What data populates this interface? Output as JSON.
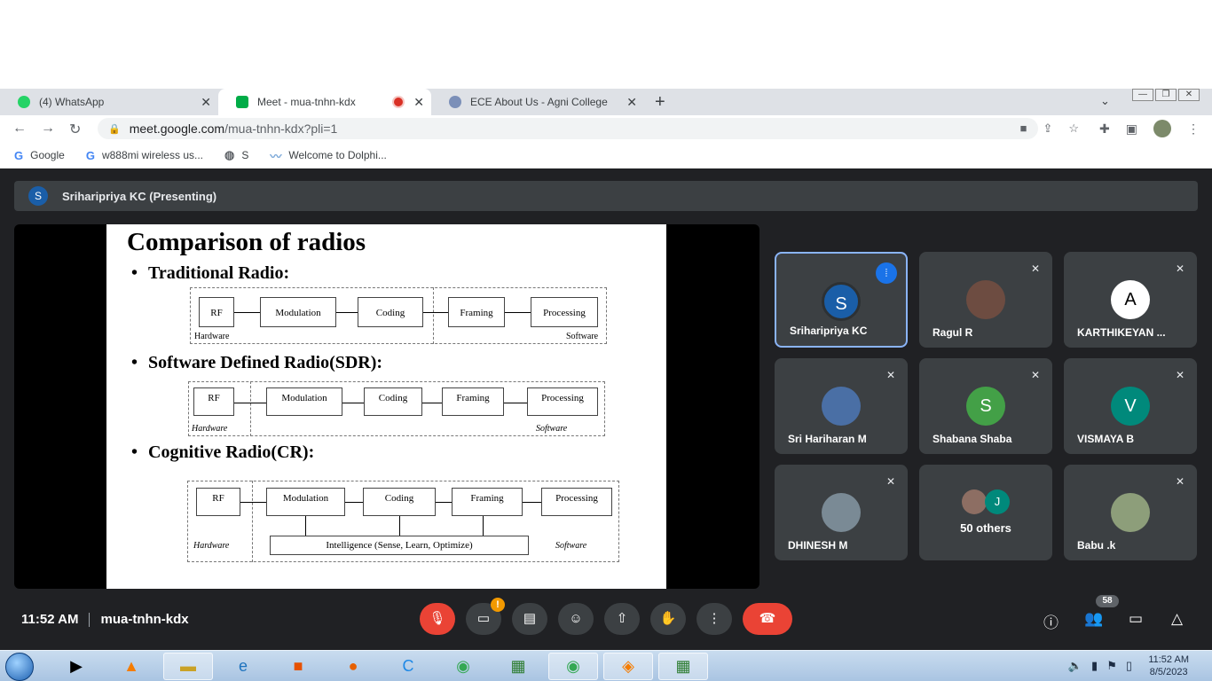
{
  "browser": {
    "tabs": [
      {
        "title": "(4) WhatsApp",
        "favicon_color": "#25d366"
      },
      {
        "title": "Meet - mua-tnhn-kdx",
        "favicon_color": "#00ac47"
      },
      {
        "title": "ECE About Us - Agni College",
        "favicon_color": "#7b8fb8"
      }
    ],
    "url_host": "meet.google.com",
    "url_path": "/mua-tnhn-kdx?pli=1",
    "bookmarks": [
      "Google",
      "w888mi wireless us...",
      "S",
      "Welcome to Dolphi..."
    ]
  },
  "meet": {
    "presenter_initial": "S",
    "presenter_label": "Sriharipriya KC (Presenting)",
    "time": "11:52 AM",
    "meeting_code": "mua-tnhn-kdx",
    "participant_count": "58",
    "participants": [
      {
        "name": "Sriharipriya KC",
        "initial": "S",
        "color": "#1a5ea8"
      },
      {
        "name": "Ragul R",
        "initial": "",
        "color": "#6d4c41"
      },
      {
        "name": "KARTHIKEYAN ...",
        "initial": "A",
        "color": "#ffffff"
      },
      {
        "name": "Sri Hariharan M",
        "initial": "",
        "color": "#4a6fa5"
      },
      {
        "name": "Shabana Shaba",
        "initial": "S",
        "color": "#43a047"
      },
      {
        "name": "VISMAYA B",
        "initial": "V",
        "color": "#00897b"
      },
      {
        "name": "DHINESH M",
        "initial": "",
        "color": "#7a8a95"
      },
      {
        "name": "Babu .k",
        "initial": "",
        "color": "#8d9e7a"
      }
    ],
    "others_initial": "J",
    "others_label": "50 others"
  },
  "slide": {
    "title": "Comparison of radios",
    "sections": [
      {
        "heading": "Traditional Radio:",
        "blocks": [
          "RF",
          "Modulation",
          "Coding",
          "Framing",
          "Processing"
        ],
        "left_label": "Hardware",
        "right_label": "Software"
      },
      {
        "heading": "Software Defined Radio(SDR):",
        "blocks": [
          "RF",
          "Modulation",
          "Coding",
          "Framing",
          "Processing"
        ],
        "left_label": "Hardware",
        "right_label": "Software"
      },
      {
        "heading": "Cognitive Radio(CR):",
        "blocks": [
          "RF",
          "Modulation",
          "Coding",
          "Framing",
          "Processing"
        ],
        "left_label": "Hardware",
        "right_label": "Software",
        "intelligence": "Intelligence (Sense, Learn, Optimize)"
      }
    ]
  },
  "taskbar": {
    "time": "11:52 AM",
    "date": "8/5/2023"
  }
}
